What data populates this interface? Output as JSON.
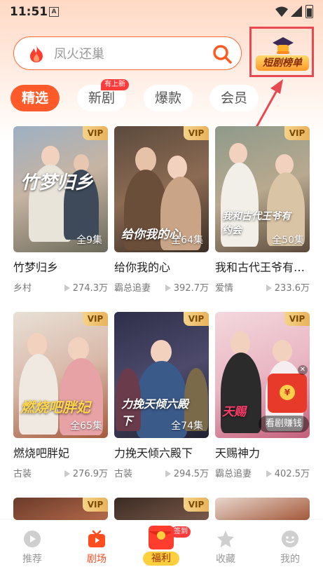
{
  "status_bar": {
    "time": "11:51",
    "notif_icon": "A"
  },
  "search": {
    "placeholder": "凤火还巢"
  },
  "ranking": {
    "label": "短剧榜单"
  },
  "tabs": [
    {
      "label": "精选",
      "active": true
    },
    {
      "label": "新剧",
      "badge": "有上新"
    },
    {
      "label": "爆款"
    },
    {
      "label": "会员"
    }
  ],
  "vip_label": "VIP",
  "dramas": [
    {
      "title": "竹梦归乡",
      "tag": "乡村",
      "views": "274.3万",
      "episodes": "全9集",
      "art": "竹梦归乡"
    },
    {
      "title": "给你我的心",
      "tag": "霸总追妻",
      "views": "392.7万",
      "episodes": "全64集",
      "art": "给你我的心"
    },
    {
      "title": "我和古代王爷有…",
      "tag": "爱情",
      "views": "233.6万",
      "episodes": "全50集",
      "art": "我和古代王爷有约会"
    },
    {
      "title": "燃烧吧胖妃",
      "tag": "古装",
      "views": "276.9万",
      "episodes": "全65集",
      "art": "燃烧吧胖妃"
    },
    {
      "title": "力挽天倾六殿下",
      "tag": "古装",
      "views": "294.5万",
      "episodes": "全74集",
      "art": "力挽天倾六殿下"
    },
    {
      "title": "天赐神力",
      "tag": "霸总追妻",
      "views": "402.5万",
      "episodes": "",
      "art": "天赐"
    }
  ],
  "promo": {
    "earn_label": "看剧赚钱",
    "coin": "¥"
  },
  "bottom_nav": [
    {
      "label": "推荐"
    },
    {
      "label": "剧场",
      "active": true
    },
    {
      "label": "福利",
      "badge": "签到"
    },
    {
      "label": "收藏"
    },
    {
      "label": "我的"
    }
  ],
  "colors": {
    "accent": "#ff5a29",
    "vip_gold": "#e8b35a",
    "highlight_red": "#e8484f"
  }
}
